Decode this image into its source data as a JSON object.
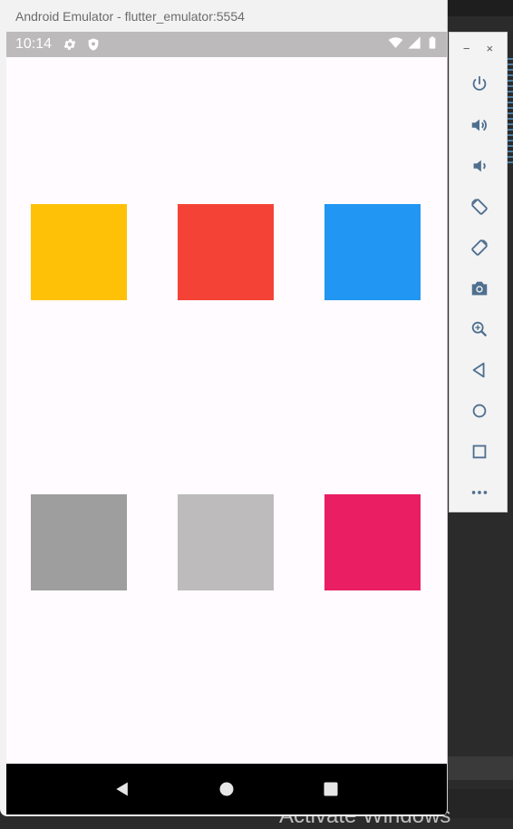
{
  "window": {
    "title": "Android Emulator - flutter_emulator:5554"
  },
  "status_bar": {
    "time": "10:14"
  },
  "squares": [
    {
      "color": "#FFC107"
    },
    {
      "color": "#F44336"
    },
    {
      "color": "#2196F3"
    },
    {
      "color": "#9E9E9E"
    },
    {
      "color": "#BDBBBB"
    },
    {
      "color": "#E91E63"
    }
  ],
  "side_toolbar": {
    "minimize_label": "−",
    "close_label": "×",
    "buttons": [
      "power-icon",
      "volume-up-icon",
      "volume-down-icon",
      "rotate-left-icon",
      "rotate-right-icon",
      "camera-icon",
      "zoom-icon",
      "back-icon",
      "home-icon",
      "overview-icon",
      "more-icon"
    ]
  },
  "background": {
    "watermark": "Activate Windows"
  },
  "colors": {
    "status_bar": "#BDBABB",
    "nav_bar": "#000000",
    "screen_bg": "#FFFBFE",
    "toolbar_icon": "#4F6F8F"
  }
}
